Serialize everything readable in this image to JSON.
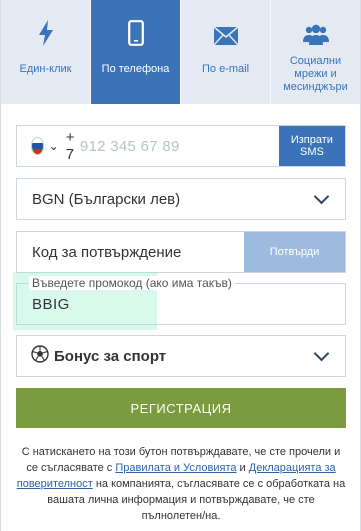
{
  "colors": {
    "accent": "#3a73b8",
    "tab_bg": "#e3eaf3",
    "register_green": "#7c9a3e",
    "confirm_disabled": "#9dbbdf",
    "link": "#2d63a8"
  },
  "tabs": [
    {
      "label": "Един-клик",
      "icon": "lightning-icon",
      "active": false
    },
    {
      "label": "По телефона",
      "icon": "smartphone-icon",
      "active": true
    },
    {
      "label": "По e-mail",
      "icon": "envelope-icon",
      "active": false
    },
    {
      "label": "Социални мрежи и месинджъри",
      "icon": "users-icon",
      "active": false
    }
  ],
  "phone": {
    "country_flag": "flag-russia-icon",
    "prefix": "+ 7",
    "placeholder": "912 345 67 89",
    "send_sms_label": "Изпрати SMS"
  },
  "currency": {
    "selected": "BGN (Български лев)"
  },
  "code": {
    "placeholder": "Код за потвърждение",
    "confirm_label": "Потвърди"
  },
  "promo": {
    "legend": "Въведете промокод (ако има такъв)",
    "value": "BBIG"
  },
  "bonus": {
    "icon": "soccer-ball-icon",
    "selected": "Бонус за спорт"
  },
  "register_label": "РЕГИСТРАЦИЯ",
  "legal": {
    "text_1": "С натискането на този бутон потвърждавате, че сте прочели и се съгласявате с ",
    "link_terms": "Правилата и Условията",
    "text_2": " и ",
    "link_privacy": "Декларацията за поверителност",
    "text_3": " на компанията, съгласявате се с обработката на вашата лична информация и потвърждавате, че сте пълнолетен/на."
  }
}
